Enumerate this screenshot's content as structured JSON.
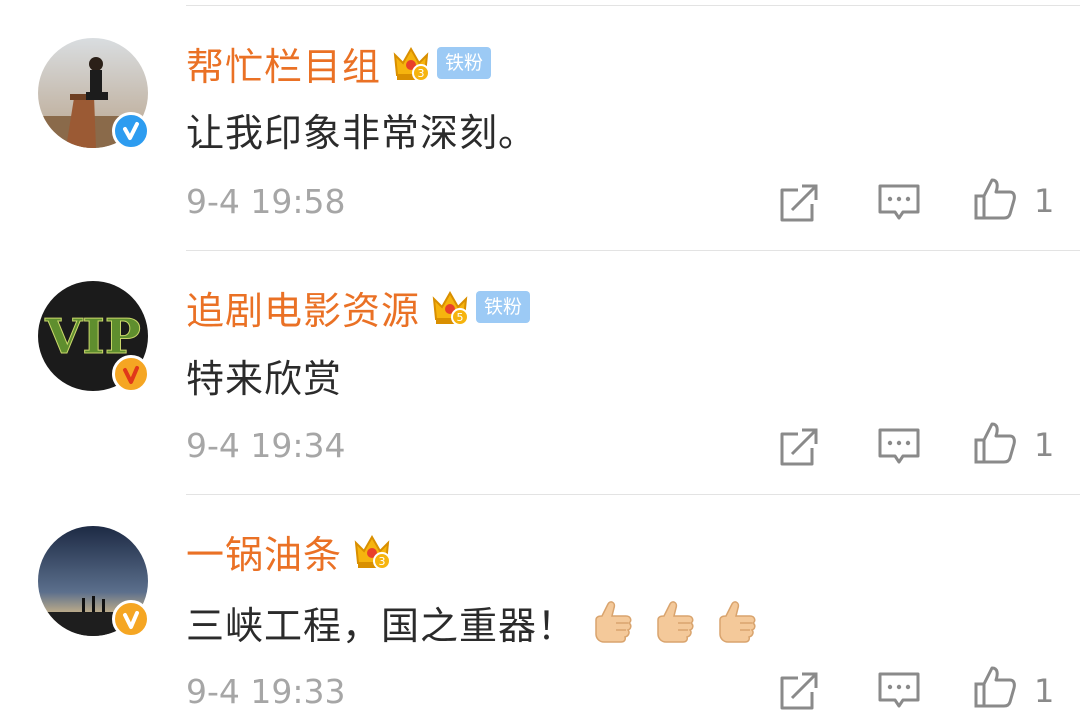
{
  "comments": [
    {
      "username": "帮忙栏目组",
      "fan_badge": "铁粉",
      "text": "让我印象非常深刻。",
      "time": "9-4 19:58",
      "likes": "1",
      "verify_color": "#2d9cf0",
      "crown_level": "3"
    },
    {
      "username": "追剧电影资源",
      "fan_badge": "铁粉",
      "text": "特来欣赏",
      "time": "9-4 19:34",
      "likes": "1",
      "verify_color": "#f5a623",
      "crown_level": "5",
      "avatar_text": "VIP"
    },
    {
      "username": "一锅油条",
      "text": "三峡工程，国之重器！",
      "emojis": [
        "thumbs-up",
        "thumbs-up",
        "thumbs-up"
      ],
      "time": "9-4 19:33",
      "likes": "1",
      "verify_color": "#f5a623",
      "crown_level": "3"
    }
  ],
  "icons": {
    "share": "share-icon",
    "comment": "comment-icon",
    "like": "like-icon",
    "crown": "crown-icon",
    "verify": "verified-icon"
  },
  "colors": {
    "username": "#ea7125",
    "time": "#a6a6a6",
    "text": "#2b2b2b",
    "fan_badge_bg": "#9ccaf5"
  }
}
